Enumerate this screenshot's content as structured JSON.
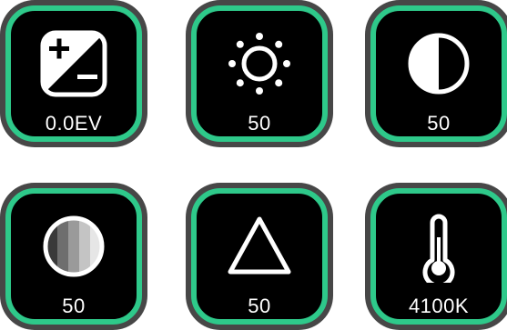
{
  "colors": {
    "tile_background": "#000000",
    "tile_border_active": "#2ec98a",
    "tile_outer_ring": "#474747",
    "icon": "#ffffff",
    "text": "#ffffff"
  },
  "tiles": [
    {
      "icon": "exposure-icon",
      "value": "0.0EV"
    },
    {
      "icon": "brightness-icon",
      "value": "50"
    },
    {
      "icon": "contrast-icon",
      "value": "50"
    },
    {
      "icon": "saturation-icon",
      "value": "50"
    },
    {
      "icon": "sharpness-icon",
      "value": "50"
    },
    {
      "icon": "thermometer-icon",
      "value": "4100K"
    }
  ]
}
